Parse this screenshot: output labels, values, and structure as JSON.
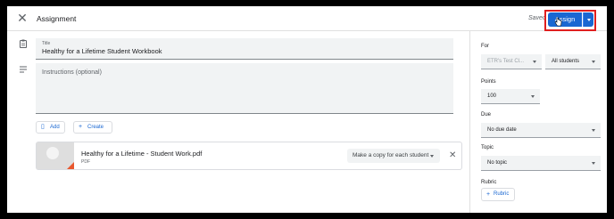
{
  "header": {
    "title": "Assignment",
    "saved_text": "Saved",
    "assign_label": "Assign",
    "accent_color": "#1967d2",
    "highlight_color": "#e01f1f"
  },
  "form": {
    "title_label": "Title",
    "title_value": "Healthy for a Lifetime Student Workbook",
    "instructions_placeholder": "Instructions (optional)",
    "add_label": "Add",
    "create_label": "Create"
  },
  "attachment": {
    "name": "Healthy for a Lifetime - Student Work.pdf",
    "type": "PDF",
    "copy_option": "Make a copy for each student"
  },
  "sidebar": {
    "for_label": "For",
    "class_value": "ETR's Test Cl...",
    "students_value": "All students",
    "points_label": "Points",
    "points_value": "100",
    "due_label": "Due",
    "due_value": "No due date",
    "topic_label": "Topic",
    "topic_value": "No topic",
    "rubric_label": "Rubric",
    "rubric_button": "Rubric"
  },
  "icons": {
    "close": "close-icon",
    "assignment": "assignment-icon",
    "instructions": "notes-icon",
    "attach": "paperclip-icon",
    "create": "plus-icon",
    "pdf": "pdf-thumbnail"
  }
}
